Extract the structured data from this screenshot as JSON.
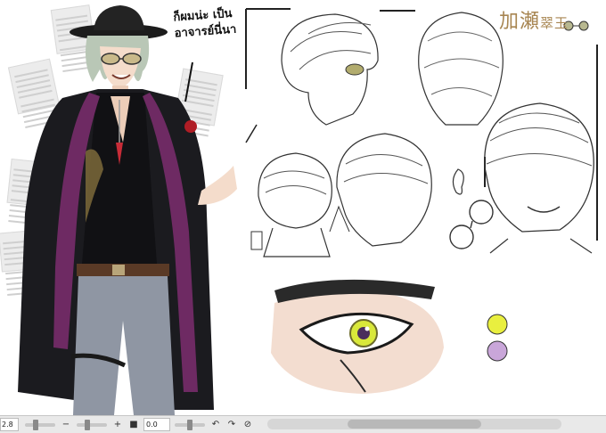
{
  "canvas": {
    "handwritten_note": "ก็ผมน่ะ เป็น\nอาจารย์นี่นา",
    "title_mark_main": "加瀬",
    "title_mark_sub": "翠玉"
  },
  "colors": {
    "coat": "#1b1b1f",
    "scarf": "#6e2a63",
    "shirt": "#111114",
    "pants": "#8f96a3",
    "belt": "#5a3a26",
    "iris": "#d9e83a",
    "swatch_yellow": "#e9ef3f",
    "swatch_purple": "#c9a6d9",
    "toolbar_bg": "#e9e9e9"
  },
  "toolbar": {
    "zoom_value": "2.8",
    "minus_icon": "−",
    "plus_icon": "+",
    "angle_value": "0.0",
    "rotate_left_icon": "↶",
    "rotate_right_icon": "↷",
    "reset_icon": "⊘",
    "zoom_slider_level": 0.35,
    "angle_slider_level": 0.5
  }
}
